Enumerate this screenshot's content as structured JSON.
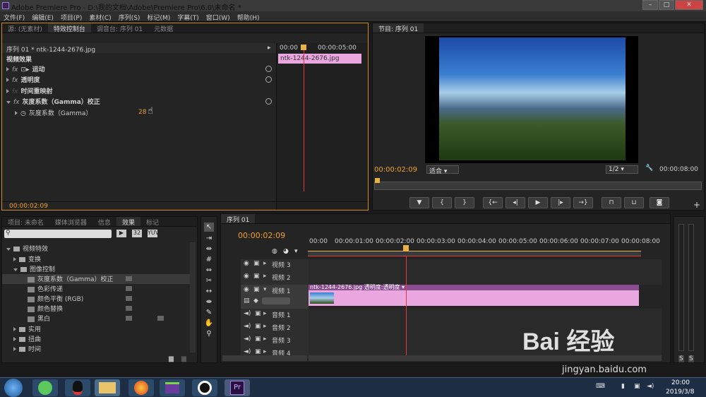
{
  "window": {
    "title": "Adobe Premiere Pro - D:\\我的文档\\Adobe\\Premiere Pro\\6.0\\未命名 *"
  },
  "menu": [
    "文件(F)",
    "编辑(E)",
    "项目(P)",
    "素材(C)",
    "序列(S)",
    "标记(M)",
    "字幕(T)",
    "窗口(W)",
    "帮助(H)"
  ],
  "source_panel": {
    "tabs": [
      "源: (无素材)",
      "特效控制台",
      "调音台: 序列 01",
      "元数据"
    ]
  },
  "effect_controls": {
    "sequence_label": "序列 01 * ntk-1244-2676.jpg",
    "section": "视频效果",
    "rows": [
      {
        "label": "运动"
      },
      {
        "label": "透明度"
      },
      {
        "label": "时间重映射"
      },
      {
        "label": "灰度系数（Gamma）校正"
      },
      {
        "label": "灰度系数（Gamma）",
        "value": "28"
      }
    ],
    "timecode": "00:00:02:09",
    "ruler": [
      "00:00",
      "00:00:05:00"
    ],
    "clip": "ntk-1244-2676.jpg"
  },
  "program": {
    "tab": "节目: 序列 01",
    "timecode": "00:00:02:09",
    "fit": "适合",
    "resolution": "1/2",
    "duration": "00:00:08:00"
  },
  "project_panel": {
    "tabs": [
      "项目: 未命名",
      "媒体浏览器",
      "信息",
      "效果",
      "标记"
    ],
    "tree": [
      {
        "label": "视频特效",
        "level": 0,
        "open": true
      },
      {
        "label": "变换",
        "level": 1
      },
      {
        "label": "图像控制",
        "level": 1,
        "open": true
      },
      {
        "label": "灰度系数（Gamma）校正",
        "level": 2,
        "selected": true
      },
      {
        "label": "色彩传递",
        "level": 2
      },
      {
        "label": "颜色平衡 (RGB)",
        "level": 2
      },
      {
        "label": "颜色替换",
        "level": 2
      },
      {
        "label": "黑白",
        "level": 2
      },
      {
        "label": "实用",
        "level": 1
      },
      {
        "label": "扭曲",
        "level": 1
      },
      {
        "label": "时间",
        "level": 1
      }
    ]
  },
  "timeline": {
    "tab": "序列 01",
    "timecode": "00:00:02:09",
    "ruler": [
      "00:00",
      "00:00:01:00",
      "00:00:02:00",
      "00:00:03:00",
      "00:00:04:00",
      "00:00:05:00",
      "00:00:06:00",
      "00:00:07:00",
      "00:00:08:00"
    ],
    "video_tracks": [
      "视频 3",
      "视频 2",
      "视频 1"
    ],
    "audio_tracks": [
      "音频 1",
      "音频 2",
      "音频 3",
      "音频 4"
    ],
    "clip_label": "ntk-1244-2676.jpg  透明度:透明度 ▾"
  },
  "audio_meter": {
    "labels": [
      "S",
      "S"
    ]
  },
  "watermark": {
    "brand": "Bai 经验",
    "url": "jingyan.baidu.com"
  },
  "taskbar": {
    "time": "20:00",
    "date": "2019/3/8"
  },
  "colors": {
    "accent": "#f0a030",
    "playhead": "#e23a3a",
    "clip": "#e9a6df",
    "clip_header": "#8a4d8f"
  }
}
